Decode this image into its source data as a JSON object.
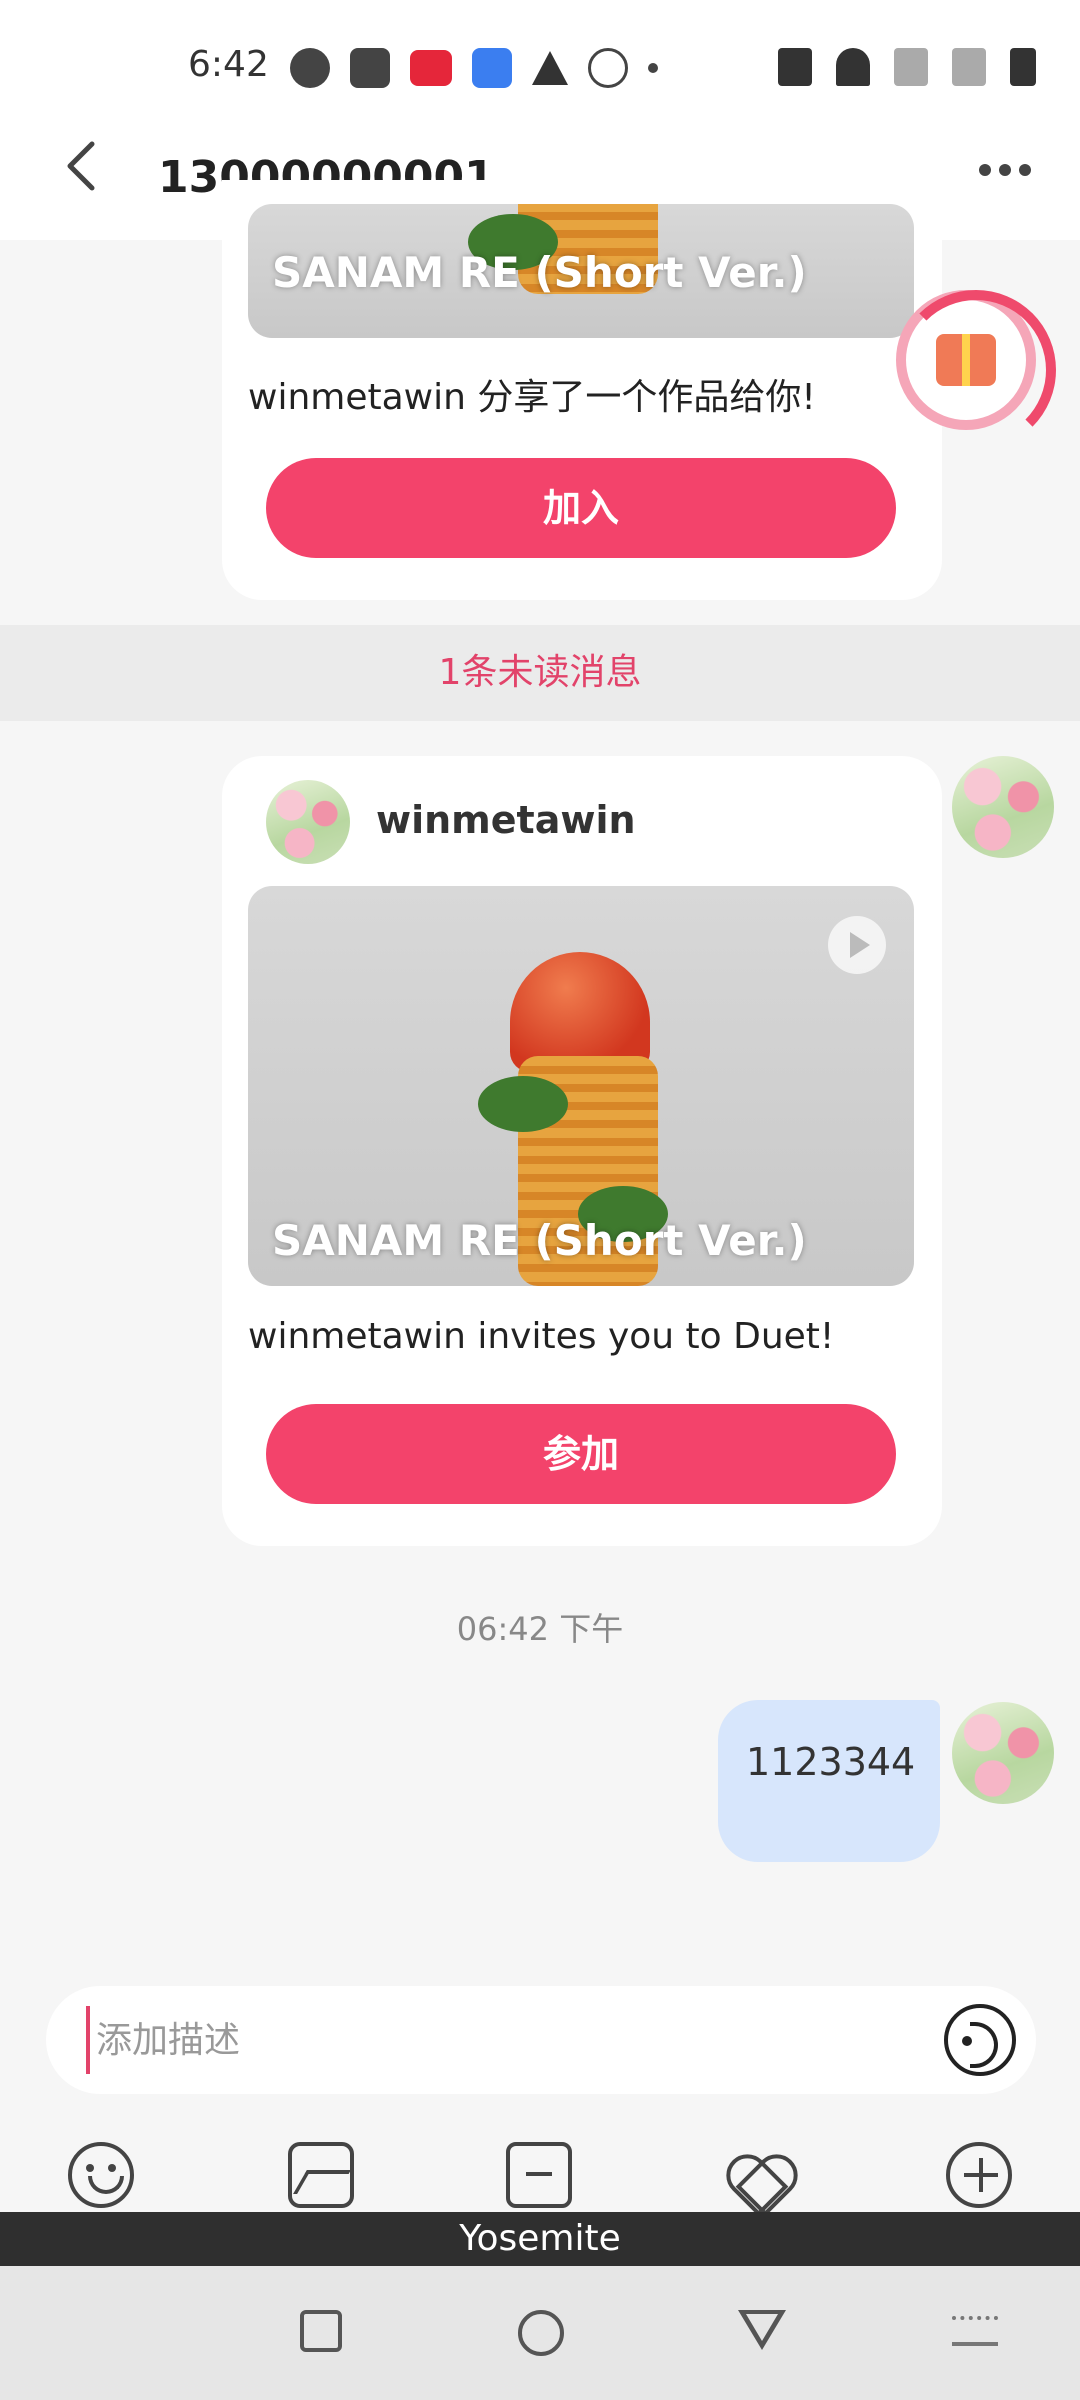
{
  "status_bar": {
    "time": "6:42"
  },
  "header": {
    "title": "13000000001"
  },
  "card1": {
    "video_title": "SANAM RE (Short Ver.)",
    "description": "winmetawin 分享了一个作品给你!",
    "button": "加入"
  },
  "unread_divider": "1条未读消息",
  "card2": {
    "sender": "winmetawin",
    "video_title": "SANAM RE (Short Ver.)",
    "description": "winmetawin invites you to Duet!",
    "button": "参加"
  },
  "timestamp": "06:42 下午",
  "my_message": "1123344",
  "composer": {
    "placeholder": "添加描述"
  },
  "keyboard_label": "Yosemite",
  "colors": {
    "accent": "#f3436b",
    "unread_text": "#e2436a",
    "bubble": "#d7e6fc"
  }
}
